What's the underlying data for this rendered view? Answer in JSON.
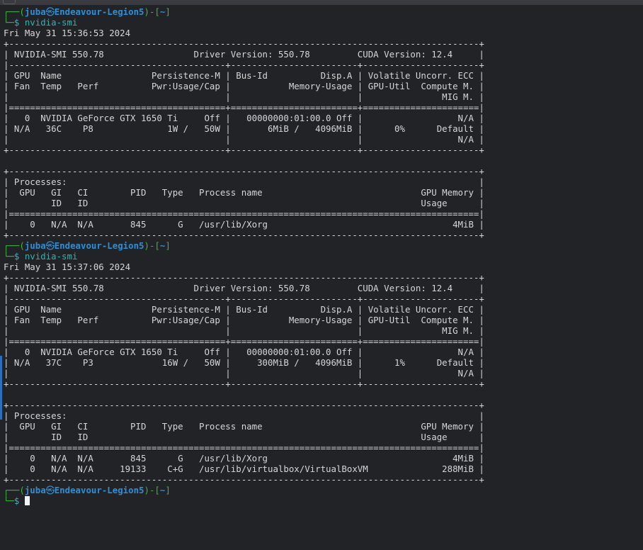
{
  "prompt": {
    "open": "┌──(",
    "user": "juba",
    "host": "Endeavour-Legion5",
    "close": ")-[",
    "path": "~",
    "end": "]",
    "second_prefix": "└─",
    "dollar": "$ "
  },
  "commands": [
    {
      "command": "nvidia-smi",
      "timestamp": "Fri May 31 15:36:53 2024",
      "output": [
        "+-----------------------------------------------------------------------------------------+",
        "| NVIDIA-SMI 550.78                 Driver Version: 550.78         CUDA Version: 12.4     |",
        "|-----------------------------------------+------------------------+----------------------+",
        "| GPU  Name                 Persistence-M | Bus-Id          Disp.A | Volatile Uncorr. ECC |",
        "| Fan  Temp   Perf          Pwr:Usage/Cap |           Memory-Usage | GPU-Util  Compute M. |",
        "|                                         |                        |               MIG M. |",
        "|=========================================+========================+======================|",
        "|   0  NVIDIA GeForce GTX 1650 Ti     Off |   00000000:01:00.0 Off |                  N/A |",
        "| N/A   36C    P8              1W /   50W |       6MiB /   4096MiB |      0%      Default |",
        "|                                         |                        |                  N/A |",
        "+-----------------------------------------+------------------------+----------------------+",
        "",
        "+-----------------------------------------------------------------------------------------+",
        "| Processes:                                                                              |",
        "|  GPU   GI   CI        PID   Type   Process name                              GPU Memory |",
        "|        ID   ID                                                               Usage      |",
        "|=========================================================================================|",
        "|    0   N/A  N/A       845      G   /usr/lib/Xorg                                   4MiB |",
        "+-----------------------------------------------------------------------------------------+"
      ]
    },
    {
      "command": "nvidia-smi",
      "timestamp": "Fri May 31 15:37:06 2024",
      "output": [
        "+-----------------------------------------------------------------------------------------+",
        "| NVIDIA-SMI 550.78                 Driver Version: 550.78         CUDA Version: 12.4     |",
        "|-----------------------------------------+------------------------+----------------------+",
        "| GPU  Name                 Persistence-M | Bus-Id          Disp.A | Volatile Uncorr. ECC |",
        "| Fan  Temp   Perf          Pwr:Usage/Cap |           Memory-Usage | GPU-Util  Compute M. |",
        "|                                         |                        |               MIG M. |",
        "|=========================================+========================+======================|",
        "|   0  NVIDIA GeForce GTX 1650 Ti     Off |   00000000:01:00.0 Off |                  N/A |",
        "| N/A   37C    P3             16W /   50W |     300MiB /   4096MiB |      1%      Default |",
        "|                                         |                        |                  N/A |",
        "+-----------------------------------------+------------------------+----------------------+",
        "",
        "+-----------------------------------------------------------------------------------------+",
        "| Processes:                                                                              |",
        "|  GPU   GI   CI        PID   Type   Process name                              GPU Memory |",
        "|        ID   ID                                                               Usage      |",
        "|=========================================================================================|",
        "|    0   N/A  N/A       845      G   /usr/lib/Xorg                                   4MiB |",
        "|    0   N/A  N/A     19133    C+G   /usr/lib/virtualbox/VirtualBoxVM              288MiB |",
        "+-----------------------------------------------------------------------------------------+"
      ]
    }
  ],
  "icons": {
    "skull": "kali-skull-icon"
  },
  "colors": {
    "background": "#222327",
    "prompt_frame": "#3fb63f",
    "prompt_user_host": "#2f8fd6",
    "command": "#2fb3b0",
    "text": "#d6d6d6"
  }
}
